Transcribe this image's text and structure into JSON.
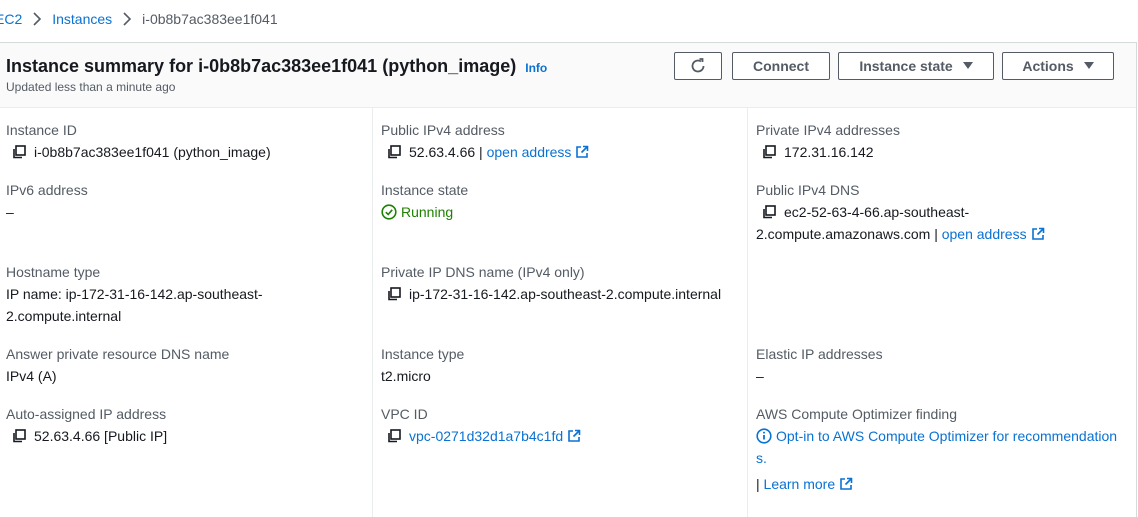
{
  "breadcrumb": {
    "first": "EC2",
    "second": "Instances",
    "current": "i-0b8b7ac383ee1f041"
  },
  "header": {
    "title": "Instance summary for i-0b8b7ac383ee1f041 (python_image)",
    "info": "Info",
    "subtitle": "Updated less than a minute ago",
    "connect": "Connect",
    "instance_state": "Instance state",
    "actions": "Actions"
  },
  "fields": {
    "instance_id": {
      "label": "Instance ID",
      "value": "i-0b8b7ac383ee1f041 (python_image)"
    },
    "ipv6": {
      "label": "IPv6 address",
      "value": "–"
    },
    "hostname_type": {
      "label": "Hostname type",
      "value": "IP name: ip-172-31-16-142.ap-southeast-2.compute.internal"
    },
    "answer_dns": {
      "label": "Answer private resource DNS name",
      "value": "IPv4 (A)"
    },
    "auto_ip": {
      "label": "Auto-assigned IP address",
      "value": "52.63.4.66 [Public IP]"
    },
    "public_ipv4": {
      "label": "Public IPv4 address",
      "value": "52.63.4.66 |",
      "link": "open address"
    },
    "instance_state": {
      "label": "Instance state",
      "value": "Running"
    },
    "private_dns": {
      "label": "Private IP DNS name (IPv4 only)",
      "value": "ip-172-31-16-142.ap-southeast-2.compute.internal"
    },
    "instance_type": {
      "label": "Instance type",
      "value": "t2.micro"
    },
    "vpc_id": {
      "label": "VPC ID",
      "value": "vpc-0271d32d1a7b4c1fd"
    },
    "private_ipv4": {
      "label": "Private IPv4 addresses",
      "value": "172.31.16.142"
    },
    "public_dns": {
      "label": "Public IPv4 DNS",
      "value": "ec2-52-63-4-66.ap-southeast-2.compute.amazonaws.com |",
      "link": "open address"
    },
    "elastic_ip": {
      "label": "Elastic IP addresses",
      "value": "–"
    },
    "optimizer": {
      "label": "AWS Compute Optimizer finding",
      "link": "Opt-in to AWS Compute Optimizer for recommendations.",
      "separator": "|",
      "learn_more": "Learn more"
    }
  },
  "colors": {
    "link": "#0972d3",
    "success": "#1d8102",
    "text": "#16191f",
    "muted": "#545b64"
  }
}
